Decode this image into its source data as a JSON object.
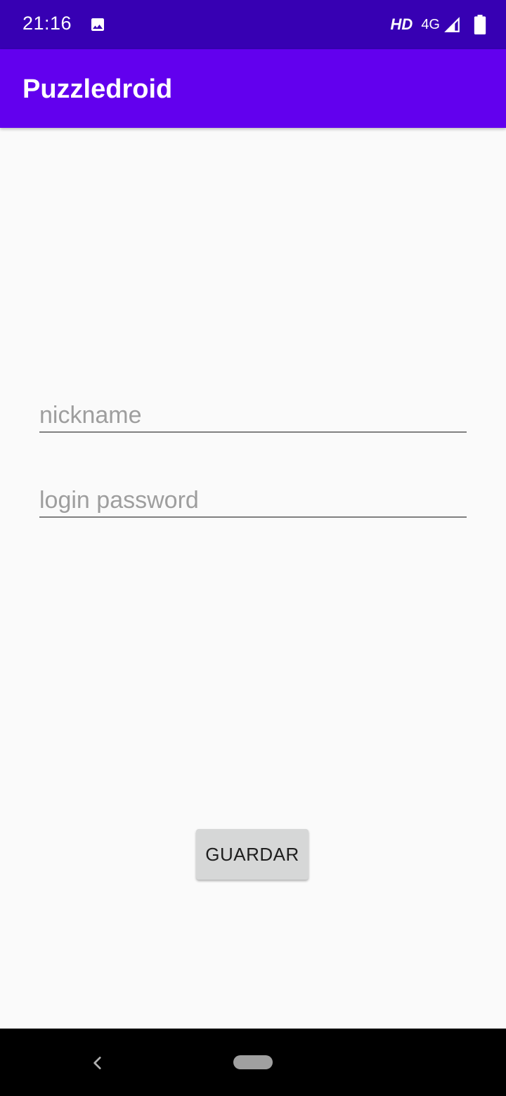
{
  "status_bar": {
    "time": "21:16",
    "hd_label": "HD",
    "network_label": "4G",
    "icons": [
      "image-icon",
      "signal-icon",
      "battery-icon"
    ]
  },
  "app_bar": {
    "title": "Puzzledroid"
  },
  "form": {
    "nickname_placeholder": "nickname",
    "password_placeholder": "login password",
    "save_label": "GUARDAR"
  },
  "nav_bar": {
    "icons": [
      "back-icon",
      "home-pill"
    ]
  },
  "colors": {
    "status_bar": "#3700b3",
    "app_bar": "#6200ee",
    "background": "#fafafa",
    "button": "#d6d7d7"
  }
}
